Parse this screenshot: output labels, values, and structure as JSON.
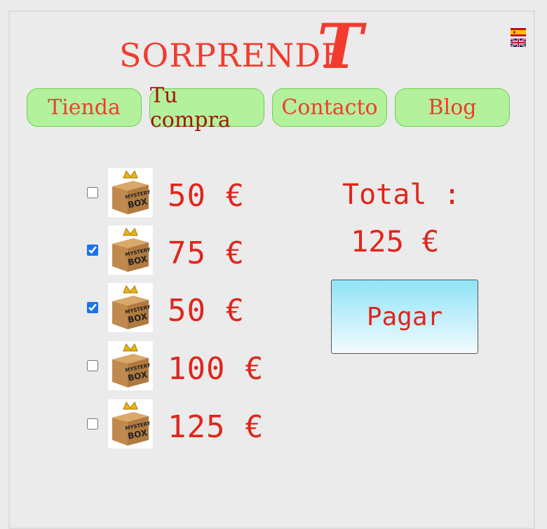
{
  "header": {
    "logo_text": "SORPRENDE",
    "logo_big_letter": "T",
    "languages": [
      {
        "name": "es-flag-icon"
      },
      {
        "name": "uk-flag-icon"
      }
    ]
  },
  "nav": [
    {
      "label": "Tienda",
      "active": false
    },
    {
      "label": "Tu compra",
      "active": true
    },
    {
      "label": "Contacto",
      "active": false
    },
    {
      "label": "Blog",
      "active": false
    }
  ],
  "cart": {
    "items": [
      {
        "price": "50 €",
        "checked": false,
        "image_text": "MYSTERY BOX"
      },
      {
        "price": "75 €",
        "checked": true,
        "image_text": "MYSTERY BOX"
      },
      {
        "price": "50 €",
        "checked": true,
        "image_text": "MYSTERY BOX"
      },
      {
        "price": "100 €",
        "checked": false,
        "image_text": "MYSTERY BOX"
      },
      {
        "price": "125 €",
        "checked": false,
        "image_text": "MYSTERY BOX"
      }
    ],
    "total_label": "Total :",
    "total_value": "125 €",
    "pay_label": "Pagar"
  },
  "colors": {
    "accent": "#e0261c",
    "nav_bg": "#b3f19c",
    "background": "#ebebeb"
  }
}
